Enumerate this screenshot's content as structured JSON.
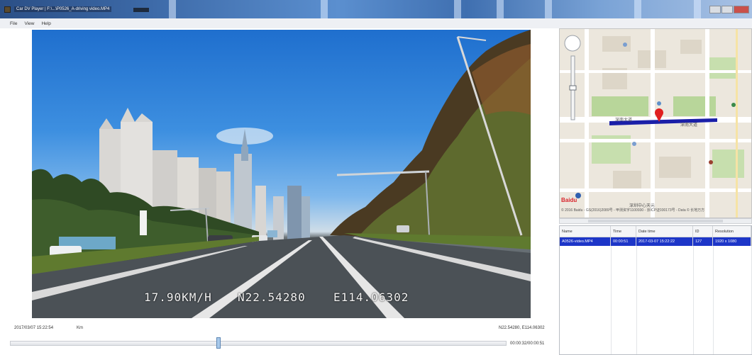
{
  "window": {
    "title": "Car DV Player | F:\\...\\P0526_A-driving video.MP4"
  },
  "menu": {
    "items": [
      "File",
      "View",
      "Help"
    ]
  },
  "video": {
    "osd_speed": "17.90KM/H",
    "osd_lat": "N22.54280",
    "osd_lon": "E114.06302"
  },
  "status": {
    "datetime": "2017/03/07 15:22:54",
    "speed_unit": "Km",
    "gps": "N22.54280, E114.06302",
    "playback_time": "00:00:32/00:00:51"
  },
  "map": {
    "provider_logo": "Baidu",
    "district_label": "深圳中心天元",
    "road_label_1": "深南大道",
    "road_label_2": "深南大道",
    "scale_text": "© 2016 Baidu - GS(2016)2089号 - 甲测资字1100930 - 京ICP证030173号 - Data © 长地万方"
  },
  "table": {
    "headers": [
      "Name",
      "Time",
      "Date time",
      "ID",
      "Resolution"
    ],
    "rows": [
      [
        "A0526-video.MP4",
        "00:00:51",
        "2017-03-07 15:22:22",
        "127",
        "1920 x 1080"
      ]
    ]
  },
  "colors": {
    "selection": "#1d36c8",
    "route": "#1a1fa8",
    "marker": "#e02020"
  }
}
